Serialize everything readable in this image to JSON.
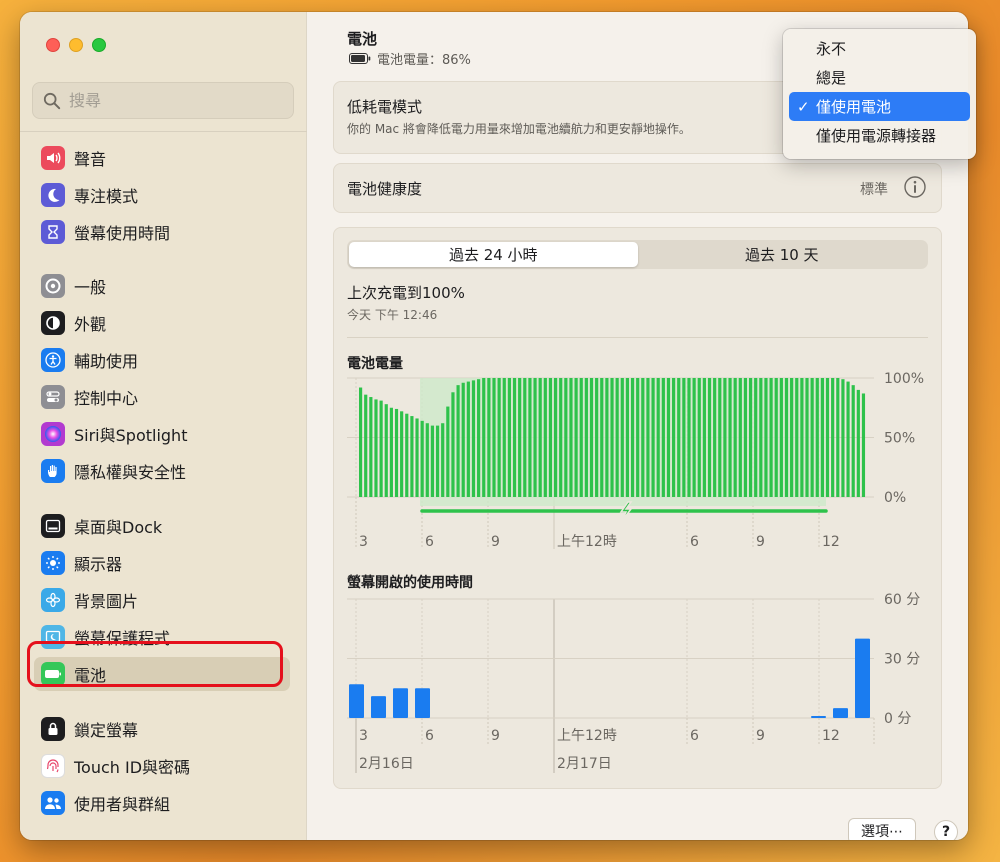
{
  "sidebar": {
    "search_placeholder": "搜尋",
    "items": [
      {
        "label": "聲音",
        "icon": "speaker-icon",
        "color": "#ec4a5c"
      },
      {
        "label": "專注模式",
        "icon": "moon-icon",
        "color": "#5d5bd6"
      },
      {
        "label": "螢幕使用時間",
        "icon": "hourglass-icon",
        "color": "#5d5bd6"
      },
      {
        "label": "一般",
        "icon": "gear-icon",
        "color": "#8e8e93"
      },
      {
        "label": "外觀",
        "icon": "appearance-icon",
        "color": "#1d1d1f"
      },
      {
        "label": "輔助使用",
        "icon": "accessibility-icon",
        "color": "#1a7cf0"
      },
      {
        "label": "控制中心",
        "icon": "toggles-icon",
        "color": "#8e8e93"
      },
      {
        "label": "Siri與Spotlight",
        "icon": "siri-icon",
        "color": "#b23ad0"
      },
      {
        "label": "隱私權與安全性",
        "icon": "hand-icon",
        "color": "#1a7cf0"
      },
      {
        "label": "桌面與Dock",
        "icon": "dock-icon",
        "color": "#1d1d1f"
      },
      {
        "label": "顯示器",
        "icon": "sun-icon",
        "color": "#1a7cf0"
      },
      {
        "label": "背景圖片",
        "icon": "flower-icon",
        "color": "#3aa9e8"
      },
      {
        "label": "螢幕保護程式",
        "icon": "screensaver-icon",
        "color": "#4fb6e6"
      },
      {
        "label": "電池",
        "icon": "battery-icon",
        "color": "#34c759"
      },
      {
        "label": "鎖定螢幕",
        "icon": "lock-icon",
        "color": "#1d1d1f"
      },
      {
        "label": "Touch ID與密碼",
        "icon": "fingerprint-icon",
        "color": "#ffffff"
      },
      {
        "label": "使用者與群組",
        "icon": "users-icon",
        "color": "#1a7cf0"
      }
    ]
  },
  "header": {
    "title": "電池",
    "battery_level": "電池電量：86%"
  },
  "low_power": {
    "title": "低耗電模式",
    "description": "你的 Mac 將會降低電力用量來增加電池續航力和更安靜地操作。"
  },
  "battery_health": {
    "label": "電池健康度",
    "value": "標準"
  },
  "tabs": {
    "last24": "過去 24 小時",
    "last10": "過去 10 天"
  },
  "last_charge": {
    "title": "上次充電到100%",
    "time": "今天 下午 12:46"
  },
  "chart_data": [
    {
      "type": "bar",
      "title": "電池電量",
      "ylim": [
        0,
        100
      ],
      "y_ticks": [
        "100%",
        "50%",
        "0%"
      ],
      "x_ticks": [
        "3",
        "6",
        "9",
        "上午12時",
        "6",
        "9",
        "12"
      ],
      "values": [
        92,
        86,
        84,
        82,
        81,
        78,
        75,
        74,
        72,
        70,
        68,
        66,
        64,
        62,
        60,
        60,
        62,
        76,
        88,
        94,
        96,
        97,
        98,
        99,
        100,
        100,
        100,
        100,
        100,
        100,
        100,
        100,
        100,
        100,
        100,
        100,
        100,
        100,
        100,
        100,
        100,
        100,
        100,
        100,
        100,
        100,
        100,
        100,
        100,
        100,
        100,
        100,
        100,
        100,
        100,
        100,
        100,
        100,
        100,
        100,
        100,
        100,
        100,
        100,
        100,
        100,
        100,
        100,
        100,
        100,
        100,
        100,
        100,
        100,
        100,
        100,
        100,
        100,
        100,
        100,
        100,
        100,
        100,
        100,
        100,
        100,
        100,
        100,
        100,
        100,
        100,
        100,
        100,
        100,
        99,
        97,
        94,
        90,
        87
      ],
      "bar_color": "#2ec24b",
      "charging_color": "#2ec24b"
    },
    {
      "type": "bar",
      "title": "螢幕開啟的使用時間",
      "ylim": [
        0,
        60
      ],
      "y_ticks": [
        "60 分",
        "30 分",
        "0 分"
      ],
      "x_ticks": [
        "3",
        "6",
        "9",
        "上午12時",
        "6",
        "9",
        "12"
      ],
      "date_labels": [
        "2月16日",
        "2月17日"
      ],
      "values": [
        17,
        11,
        15,
        15,
        0,
        0,
        0,
        0,
        0,
        0,
        0,
        0,
        0,
        0,
        0,
        0,
        0,
        0,
        0,
        0,
        0,
        1,
        5,
        40
      ],
      "bar_color": "#1a7cf0"
    }
  ],
  "footer": {
    "options_label": "選項⋯",
    "help_label": "?"
  },
  "menu": {
    "items": [
      "永不",
      "總是",
      "僅使用電池",
      "僅使用電源轉接器"
    ],
    "selected": 2,
    "check": "✓"
  }
}
